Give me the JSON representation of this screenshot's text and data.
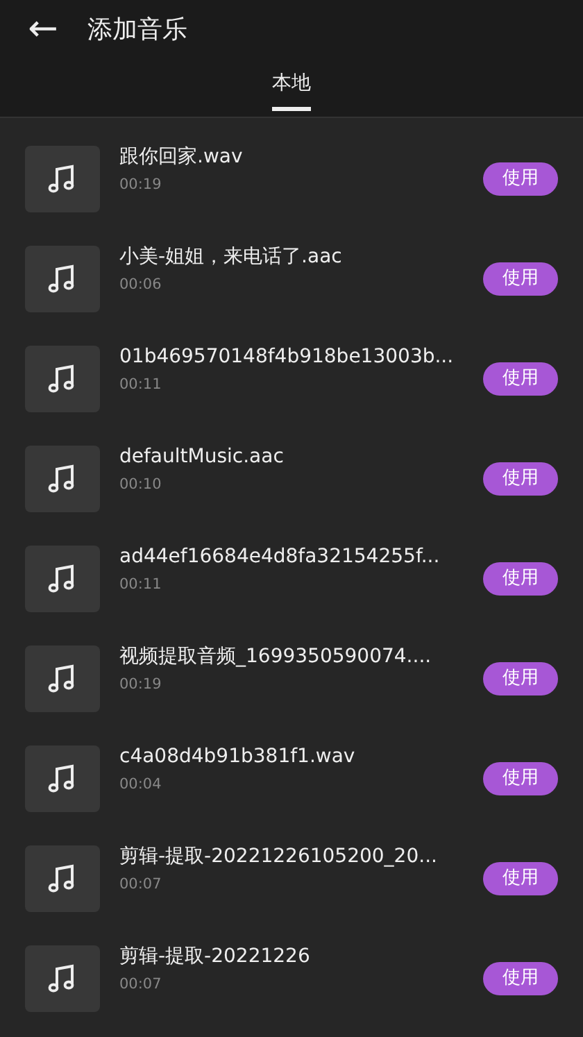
{
  "header": {
    "back": "←",
    "title": "添加音乐"
  },
  "tabs": [
    {
      "label": "本地",
      "selected": true
    }
  ],
  "tracks": [
    {
      "name": "跟你回家.wav",
      "duration": "00:19",
      "action": "使用"
    },
    {
      "name": "小美-姐姐，来电话了.aac",
      "duration": "00:06",
      "action": "使用"
    },
    {
      "name": "01b469570148f4b918be13003b...",
      "duration": "00:11",
      "action": "使用"
    },
    {
      "name": "defaultMusic.aac",
      "duration": "00:10",
      "action": "使用"
    },
    {
      "name": "ad44ef16684e4d8fa32154255f...",
      "duration": "00:11",
      "action": "使用"
    },
    {
      "name": "视频提取音频_1699350590074....",
      "duration": "00:19",
      "action": "使用"
    },
    {
      "name": "c4a08d4b91b381f1.wav",
      "duration": "00:04",
      "action": "使用"
    },
    {
      "name": "剪辑-提取-20221226105200_20...",
      "duration": "00:07",
      "action": "使用"
    },
    {
      "name": "剪辑-提取-20221226",
      "duration": "00:07",
      "action": "使用"
    }
  ]
}
